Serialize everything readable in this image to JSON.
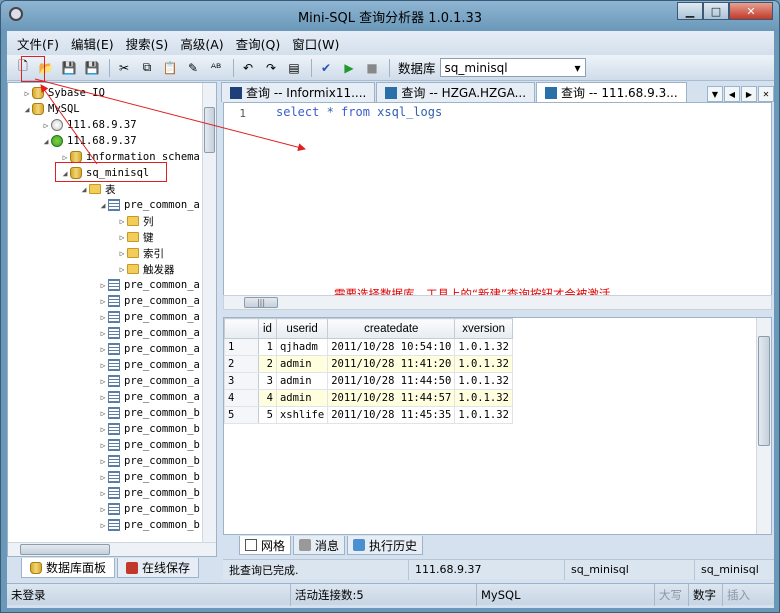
{
  "window": {
    "title": "Mini-SQL 查询分析器 1.0.1.33",
    "minimize": "▁",
    "maximize": "□",
    "close": "✕"
  },
  "menu": [
    "文件(F)",
    "编辑(E)",
    "搜索(S)",
    "高级(A)",
    "查询(Q)",
    "窗口(W)"
  ],
  "toolbar": {
    "icons": [
      "new-query-icon",
      "open-icon",
      "save-icon",
      "save-as-icon",
      "cut-icon",
      "copy-icon",
      "paste-icon",
      "eraser-icon",
      "spellcheck-icon",
      "undo-icon",
      "redo-icon",
      "window-icon",
      "check-icon",
      "run-icon",
      "stop-icon"
    ],
    "glyphs": [
      "🗋",
      "📂",
      "💾",
      "💾",
      "✂",
      "⧉",
      "📋",
      "✎",
      "ᴬᴮ",
      "↶",
      "↷",
      "▤",
      "✔",
      "▶",
      "■"
    ],
    "db_label": "数据库",
    "db_value": "sq_minisql",
    "dropdown": "▾"
  },
  "tree": {
    "nodes": [
      {
        "label": "Sybase IQ",
        "icon": "db"
      },
      {
        "label": "MySQL",
        "icon": "db"
      },
      {
        "label": "111.68.9.37",
        "icon": "srv"
      },
      {
        "label": "111.68.9.37",
        "icon": "srv2"
      },
      {
        "label": "information_schema",
        "icon": "db"
      },
      {
        "label": "sq_minisql",
        "icon": "db"
      },
      {
        "label": "表",
        "icon": "folder"
      },
      {
        "label": "pre_common_a",
        "icon": "table"
      },
      {
        "label": "列",
        "icon": "folder"
      },
      {
        "label": "键",
        "icon": "folder"
      },
      {
        "label": "索引",
        "icon": "folder"
      },
      {
        "label": "触发器",
        "icon": "folder"
      },
      {
        "label": "pre_common_a",
        "icon": "table"
      },
      {
        "label": "pre_common_a",
        "icon": "table"
      },
      {
        "label": "pre_common_a",
        "icon": "table"
      },
      {
        "label": "pre_common_a",
        "icon": "table"
      },
      {
        "label": "pre_common_a",
        "icon": "table"
      },
      {
        "label": "pre_common_a",
        "icon": "table"
      },
      {
        "label": "pre_common_a",
        "icon": "table"
      },
      {
        "label": "pre_common_a",
        "icon": "table"
      },
      {
        "label": "pre_common_b",
        "icon": "table"
      },
      {
        "label": "pre_common_b",
        "icon": "table"
      },
      {
        "label": "pre_common_b",
        "icon": "table"
      },
      {
        "label": "pre_common_b",
        "icon": "table"
      },
      {
        "label": "pre_common_b",
        "icon": "table"
      },
      {
        "label": "pre_common_b",
        "icon": "table"
      },
      {
        "label": "pre_common_b",
        "icon": "table"
      },
      {
        "label": "pre_common_b",
        "icon": "table"
      }
    ]
  },
  "left_tabs": [
    {
      "label": "数据库面板"
    },
    {
      "label": "在线保存"
    }
  ],
  "query_tabs": [
    {
      "label": "查询 -- Informix11...."
    },
    {
      "label": "查询 -- HZGA.HZGA..."
    },
    {
      "label": "查询 -- 111.68.9.3..."
    }
  ],
  "editor": {
    "line": "1",
    "code": [
      {
        "t": "select",
        "kw": true
      },
      {
        "t": " * ",
        "kw": false
      },
      {
        "t": "from",
        "kw": true
      },
      {
        "t": " xsql_logs",
        "kw": false
      }
    ],
    "annotation": "需要选择数据库，工具上的“新建”查询按钮才会被激活"
  },
  "results": {
    "columns": [
      "id",
      "userid",
      "createdate",
      "xversion"
    ],
    "rows": [
      [
        "1",
        "1",
        "qjhadm",
        "2011/10/28 10:54:10",
        "1.0.1.32"
      ],
      [
        "2",
        "2",
        "admin",
        "2011/10/28 11:41:20",
        "1.0.1.32"
      ],
      [
        "3",
        "3",
        "admin",
        "2011/10/28 11:44:50",
        "1.0.1.32"
      ],
      [
        "4",
        "4",
        "admin",
        "2011/10/28 11:44:57",
        "1.0.1.32"
      ],
      [
        "5",
        "5",
        "xshlife",
        "2011/10/28 11:45:35",
        "1.0.1.32"
      ]
    ]
  },
  "result_tabs": [
    {
      "label": "网格"
    },
    {
      "label": "消息"
    },
    {
      "label": "执行历史"
    }
  ],
  "query_status": {
    "message": "批查询已完成.",
    "server": "111.68.9.37",
    "db1": "sq_minisql",
    "db2": "sq_minisql"
  },
  "statusbar": {
    "login": "未登录",
    "connections": "活动连接数:5",
    "engine": "MySQL",
    "caps": "大写",
    "num": "数字",
    "ins": "插入"
  }
}
